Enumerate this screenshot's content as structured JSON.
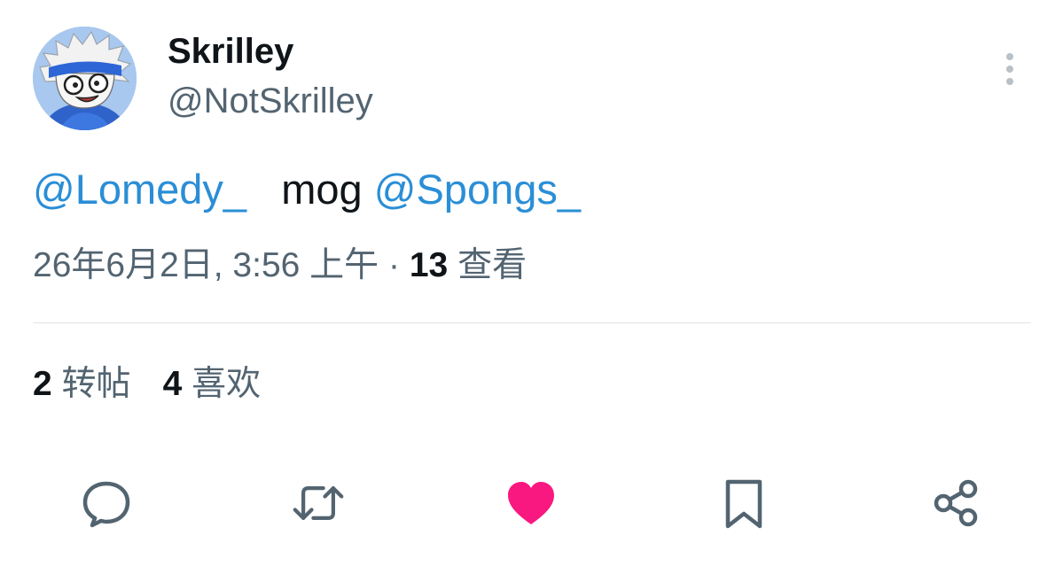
{
  "author": {
    "display_name": "Skrilley",
    "handle": "@NotSkrilley",
    "avatar_icon": "avatar-cartoon-white-hair-blue-headband"
  },
  "tweet": {
    "mention_1": "@Lomedy_",
    "word": "mog",
    "mention_2": "@Spongs_"
  },
  "meta": {
    "timestamp": "26年6月2日, 3:56 上午",
    "separator": "·",
    "views_count": "13",
    "views_label": "查看"
  },
  "stats": {
    "retweets_count": "2",
    "retweets_label": "转帖",
    "likes_count": "4",
    "likes_label": "喜欢"
  },
  "actions": {
    "reply_icon": "speech-bubble-icon",
    "retweet_icon": "retweet-arrows-icon",
    "like_icon": "heart-icon",
    "bookmark_icon": "bookmark-icon",
    "share_icon": "share-nodes-icon"
  },
  "colors": {
    "mention": "#2a8ed6",
    "secondary_text": "#536471",
    "primary_text": "#0f1419",
    "like_active": "#f91880",
    "divider": "#dfe3e6"
  }
}
